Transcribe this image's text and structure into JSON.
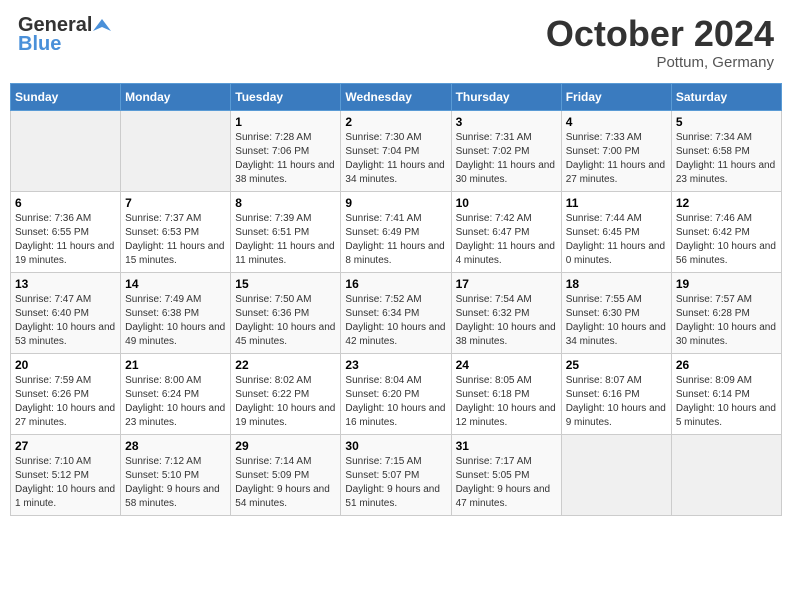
{
  "header": {
    "logo_general": "General",
    "logo_blue": "Blue",
    "month": "October 2024",
    "location": "Pottum, Germany"
  },
  "weekdays": [
    "Sunday",
    "Monday",
    "Tuesday",
    "Wednesday",
    "Thursday",
    "Friday",
    "Saturday"
  ],
  "rows": [
    [
      {
        "day": "",
        "sunrise": "",
        "sunset": "",
        "daylight": ""
      },
      {
        "day": "",
        "sunrise": "",
        "sunset": "",
        "daylight": ""
      },
      {
        "day": "1",
        "sunrise": "Sunrise: 7:28 AM",
        "sunset": "Sunset: 7:06 PM",
        "daylight": "Daylight: 11 hours and 38 minutes."
      },
      {
        "day": "2",
        "sunrise": "Sunrise: 7:30 AM",
        "sunset": "Sunset: 7:04 PM",
        "daylight": "Daylight: 11 hours and 34 minutes."
      },
      {
        "day": "3",
        "sunrise": "Sunrise: 7:31 AM",
        "sunset": "Sunset: 7:02 PM",
        "daylight": "Daylight: 11 hours and 30 minutes."
      },
      {
        "day": "4",
        "sunrise": "Sunrise: 7:33 AM",
        "sunset": "Sunset: 7:00 PM",
        "daylight": "Daylight: 11 hours and 27 minutes."
      },
      {
        "day": "5",
        "sunrise": "Sunrise: 7:34 AM",
        "sunset": "Sunset: 6:58 PM",
        "daylight": "Daylight: 11 hours and 23 minutes."
      }
    ],
    [
      {
        "day": "6",
        "sunrise": "Sunrise: 7:36 AM",
        "sunset": "Sunset: 6:55 PM",
        "daylight": "Daylight: 11 hours and 19 minutes."
      },
      {
        "day": "7",
        "sunrise": "Sunrise: 7:37 AM",
        "sunset": "Sunset: 6:53 PM",
        "daylight": "Daylight: 11 hours and 15 minutes."
      },
      {
        "day": "8",
        "sunrise": "Sunrise: 7:39 AM",
        "sunset": "Sunset: 6:51 PM",
        "daylight": "Daylight: 11 hours and 11 minutes."
      },
      {
        "day": "9",
        "sunrise": "Sunrise: 7:41 AM",
        "sunset": "Sunset: 6:49 PM",
        "daylight": "Daylight: 11 hours and 8 minutes."
      },
      {
        "day": "10",
        "sunrise": "Sunrise: 7:42 AM",
        "sunset": "Sunset: 6:47 PM",
        "daylight": "Daylight: 11 hours and 4 minutes."
      },
      {
        "day": "11",
        "sunrise": "Sunrise: 7:44 AM",
        "sunset": "Sunset: 6:45 PM",
        "daylight": "Daylight: 11 hours and 0 minutes."
      },
      {
        "day": "12",
        "sunrise": "Sunrise: 7:46 AM",
        "sunset": "Sunset: 6:42 PM",
        "daylight": "Daylight: 10 hours and 56 minutes."
      }
    ],
    [
      {
        "day": "13",
        "sunrise": "Sunrise: 7:47 AM",
        "sunset": "Sunset: 6:40 PM",
        "daylight": "Daylight: 10 hours and 53 minutes."
      },
      {
        "day": "14",
        "sunrise": "Sunrise: 7:49 AM",
        "sunset": "Sunset: 6:38 PM",
        "daylight": "Daylight: 10 hours and 49 minutes."
      },
      {
        "day": "15",
        "sunrise": "Sunrise: 7:50 AM",
        "sunset": "Sunset: 6:36 PM",
        "daylight": "Daylight: 10 hours and 45 minutes."
      },
      {
        "day": "16",
        "sunrise": "Sunrise: 7:52 AM",
        "sunset": "Sunset: 6:34 PM",
        "daylight": "Daylight: 10 hours and 42 minutes."
      },
      {
        "day": "17",
        "sunrise": "Sunrise: 7:54 AM",
        "sunset": "Sunset: 6:32 PM",
        "daylight": "Daylight: 10 hours and 38 minutes."
      },
      {
        "day": "18",
        "sunrise": "Sunrise: 7:55 AM",
        "sunset": "Sunset: 6:30 PM",
        "daylight": "Daylight: 10 hours and 34 minutes."
      },
      {
        "day": "19",
        "sunrise": "Sunrise: 7:57 AM",
        "sunset": "Sunset: 6:28 PM",
        "daylight": "Daylight: 10 hours and 30 minutes."
      }
    ],
    [
      {
        "day": "20",
        "sunrise": "Sunrise: 7:59 AM",
        "sunset": "Sunset: 6:26 PM",
        "daylight": "Daylight: 10 hours and 27 minutes."
      },
      {
        "day": "21",
        "sunrise": "Sunrise: 8:00 AM",
        "sunset": "Sunset: 6:24 PM",
        "daylight": "Daylight: 10 hours and 23 minutes."
      },
      {
        "day": "22",
        "sunrise": "Sunrise: 8:02 AM",
        "sunset": "Sunset: 6:22 PM",
        "daylight": "Daylight: 10 hours and 19 minutes."
      },
      {
        "day": "23",
        "sunrise": "Sunrise: 8:04 AM",
        "sunset": "Sunset: 6:20 PM",
        "daylight": "Daylight: 10 hours and 16 minutes."
      },
      {
        "day": "24",
        "sunrise": "Sunrise: 8:05 AM",
        "sunset": "Sunset: 6:18 PM",
        "daylight": "Daylight: 10 hours and 12 minutes."
      },
      {
        "day": "25",
        "sunrise": "Sunrise: 8:07 AM",
        "sunset": "Sunset: 6:16 PM",
        "daylight": "Daylight: 10 hours and 9 minutes."
      },
      {
        "day": "26",
        "sunrise": "Sunrise: 8:09 AM",
        "sunset": "Sunset: 6:14 PM",
        "daylight": "Daylight: 10 hours and 5 minutes."
      }
    ],
    [
      {
        "day": "27",
        "sunrise": "Sunrise: 7:10 AM",
        "sunset": "Sunset: 5:12 PM",
        "daylight": "Daylight: 10 hours and 1 minute."
      },
      {
        "day": "28",
        "sunrise": "Sunrise: 7:12 AM",
        "sunset": "Sunset: 5:10 PM",
        "daylight": "Daylight: 9 hours and 58 minutes."
      },
      {
        "day": "29",
        "sunrise": "Sunrise: 7:14 AM",
        "sunset": "Sunset: 5:09 PM",
        "daylight": "Daylight: 9 hours and 54 minutes."
      },
      {
        "day": "30",
        "sunrise": "Sunrise: 7:15 AM",
        "sunset": "Sunset: 5:07 PM",
        "daylight": "Daylight: 9 hours and 51 minutes."
      },
      {
        "day": "31",
        "sunrise": "Sunrise: 7:17 AM",
        "sunset": "Sunset: 5:05 PM",
        "daylight": "Daylight: 9 hours and 47 minutes."
      },
      {
        "day": "",
        "sunrise": "",
        "sunset": "",
        "daylight": ""
      },
      {
        "day": "",
        "sunrise": "",
        "sunset": "",
        "daylight": ""
      }
    ]
  ]
}
